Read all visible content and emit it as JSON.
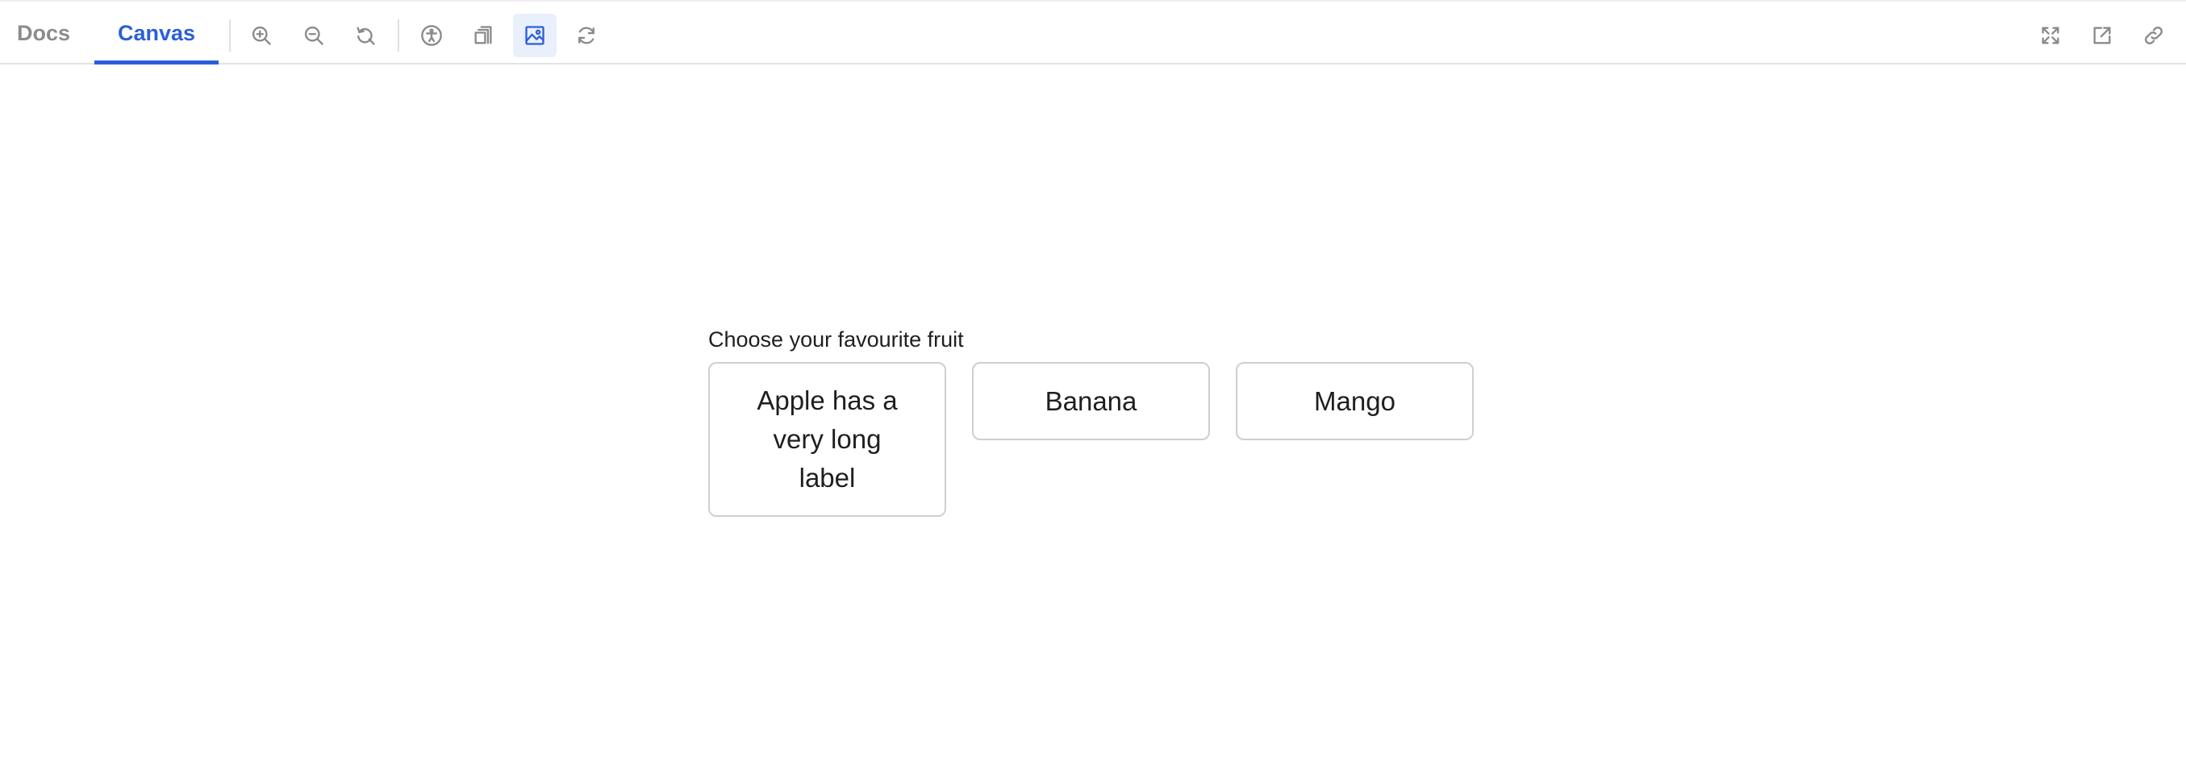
{
  "toolbar": {
    "tabs": [
      {
        "label": "Docs",
        "active": false
      },
      {
        "label": "Canvas",
        "active": true
      }
    ],
    "tools_left": [
      {
        "icon": "zoom-in-icon"
      },
      {
        "icon": "zoom-out-icon"
      },
      {
        "icon": "reset-zoom-icon"
      },
      {
        "icon": "accessibility-icon"
      },
      {
        "icon": "outline-icon"
      },
      {
        "icon": "background-image-icon",
        "active": true
      },
      {
        "icon": "remount-icon"
      }
    ],
    "tools_right": [
      {
        "icon": "fullscreen-icon"
      },
      {
        "icon": "open-new-tab-icon"
      },
      {
        "icon": "copy-link-icon"
      }
    ],
    "accent_color": "#2b5fd9"
  },
  "canvas": {
    "question": "Choose your favourite fruit",
    "options": [
      {
        "label": "Apple has a very long label"
      },
      {
        "label": "Banana"
      },
      {
        "label": "Mango"
      }
    ]
  }
}
